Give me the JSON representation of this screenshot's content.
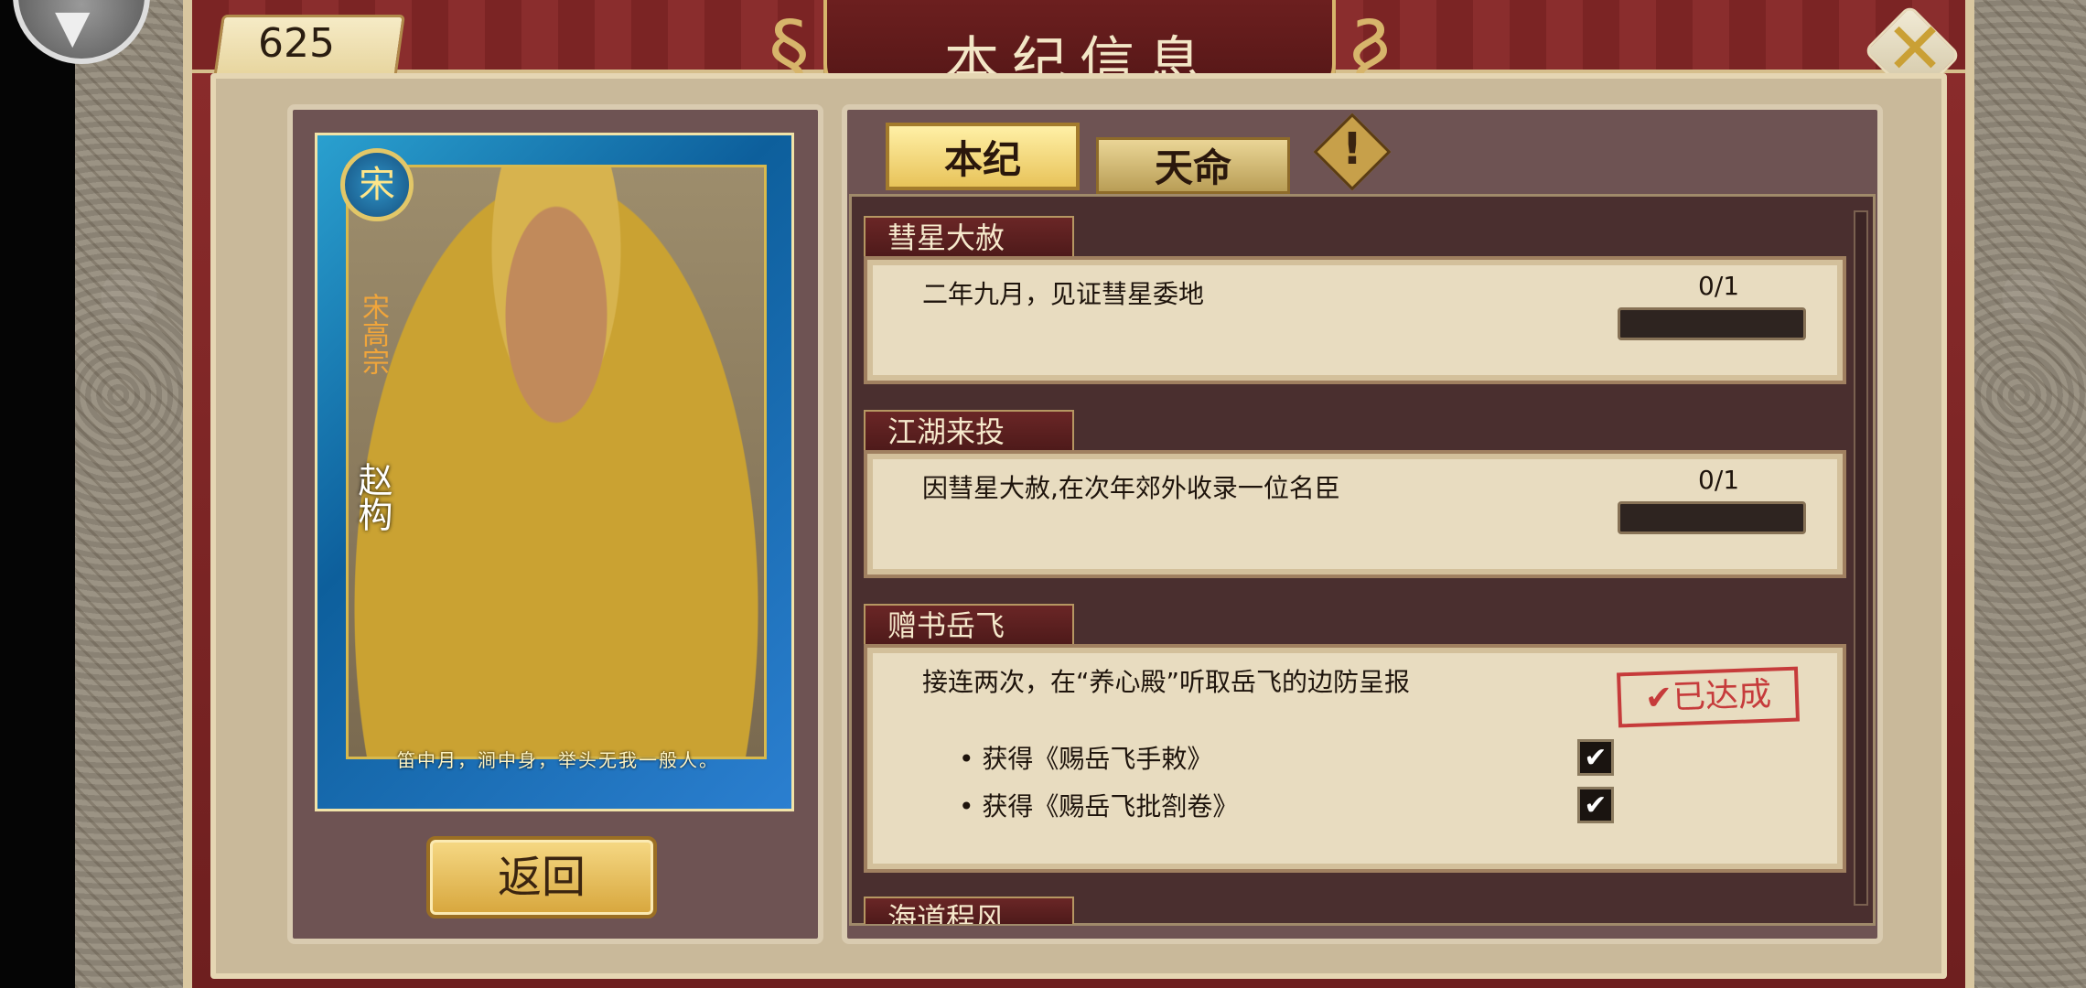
{
  "header": {
    "score": "625",
    "title": "本纪信息"
  },
  "icons": {
    "close": "close-icon",
    "menu": "menu-arrow-icon",
    "info": "exclamation-icon"
  },
  "character": {
    "seal": "宋",
    "title": "宋高宗",
    "name": "赵构",
    "quote": "笛中月，涧中身，举头无我一般人。"
  },
  "buttons": {
    "back": "返回"
  },
  "tabs": [
    {
      "label": "本纪",
      "active": true
    },
    {
      "label": "天命",
      "active": false
    }
  ],
  "quests": [
    {
      "title": "彗星大赦",
      "desc": "二年九月，见证彗星委地",
      "progress": "0/1",
      "progress_value": 0
    },
    {
      "title": "江湖来投",
      "desc": "因彗星大赦,在次年郊外收录一位名臣",
      "progress": "0/1",
      "progress_value": 0
    },
    {
      "title": "赠书岳飞",
      "desc": "接连两次，在“养心殿”听取岳飞的边防呈报",
      "status": "已达成",
      "rewards": [
        {
          "label": "获得《赐岳飞手敕》",
          "checked": true
        },
        {
          "label": "获得《赐岳飞批劄卷》",
          "checked": true
        }
      ]
    },
    {
      "title": "海道程风"
    }
  ],
  "colors": {
    "frame": "#8c2c2c",
    "panel": "#6e5353",
    "accent": "#e8c35a",
    "stamp": "#c63b3b"
  }
}
